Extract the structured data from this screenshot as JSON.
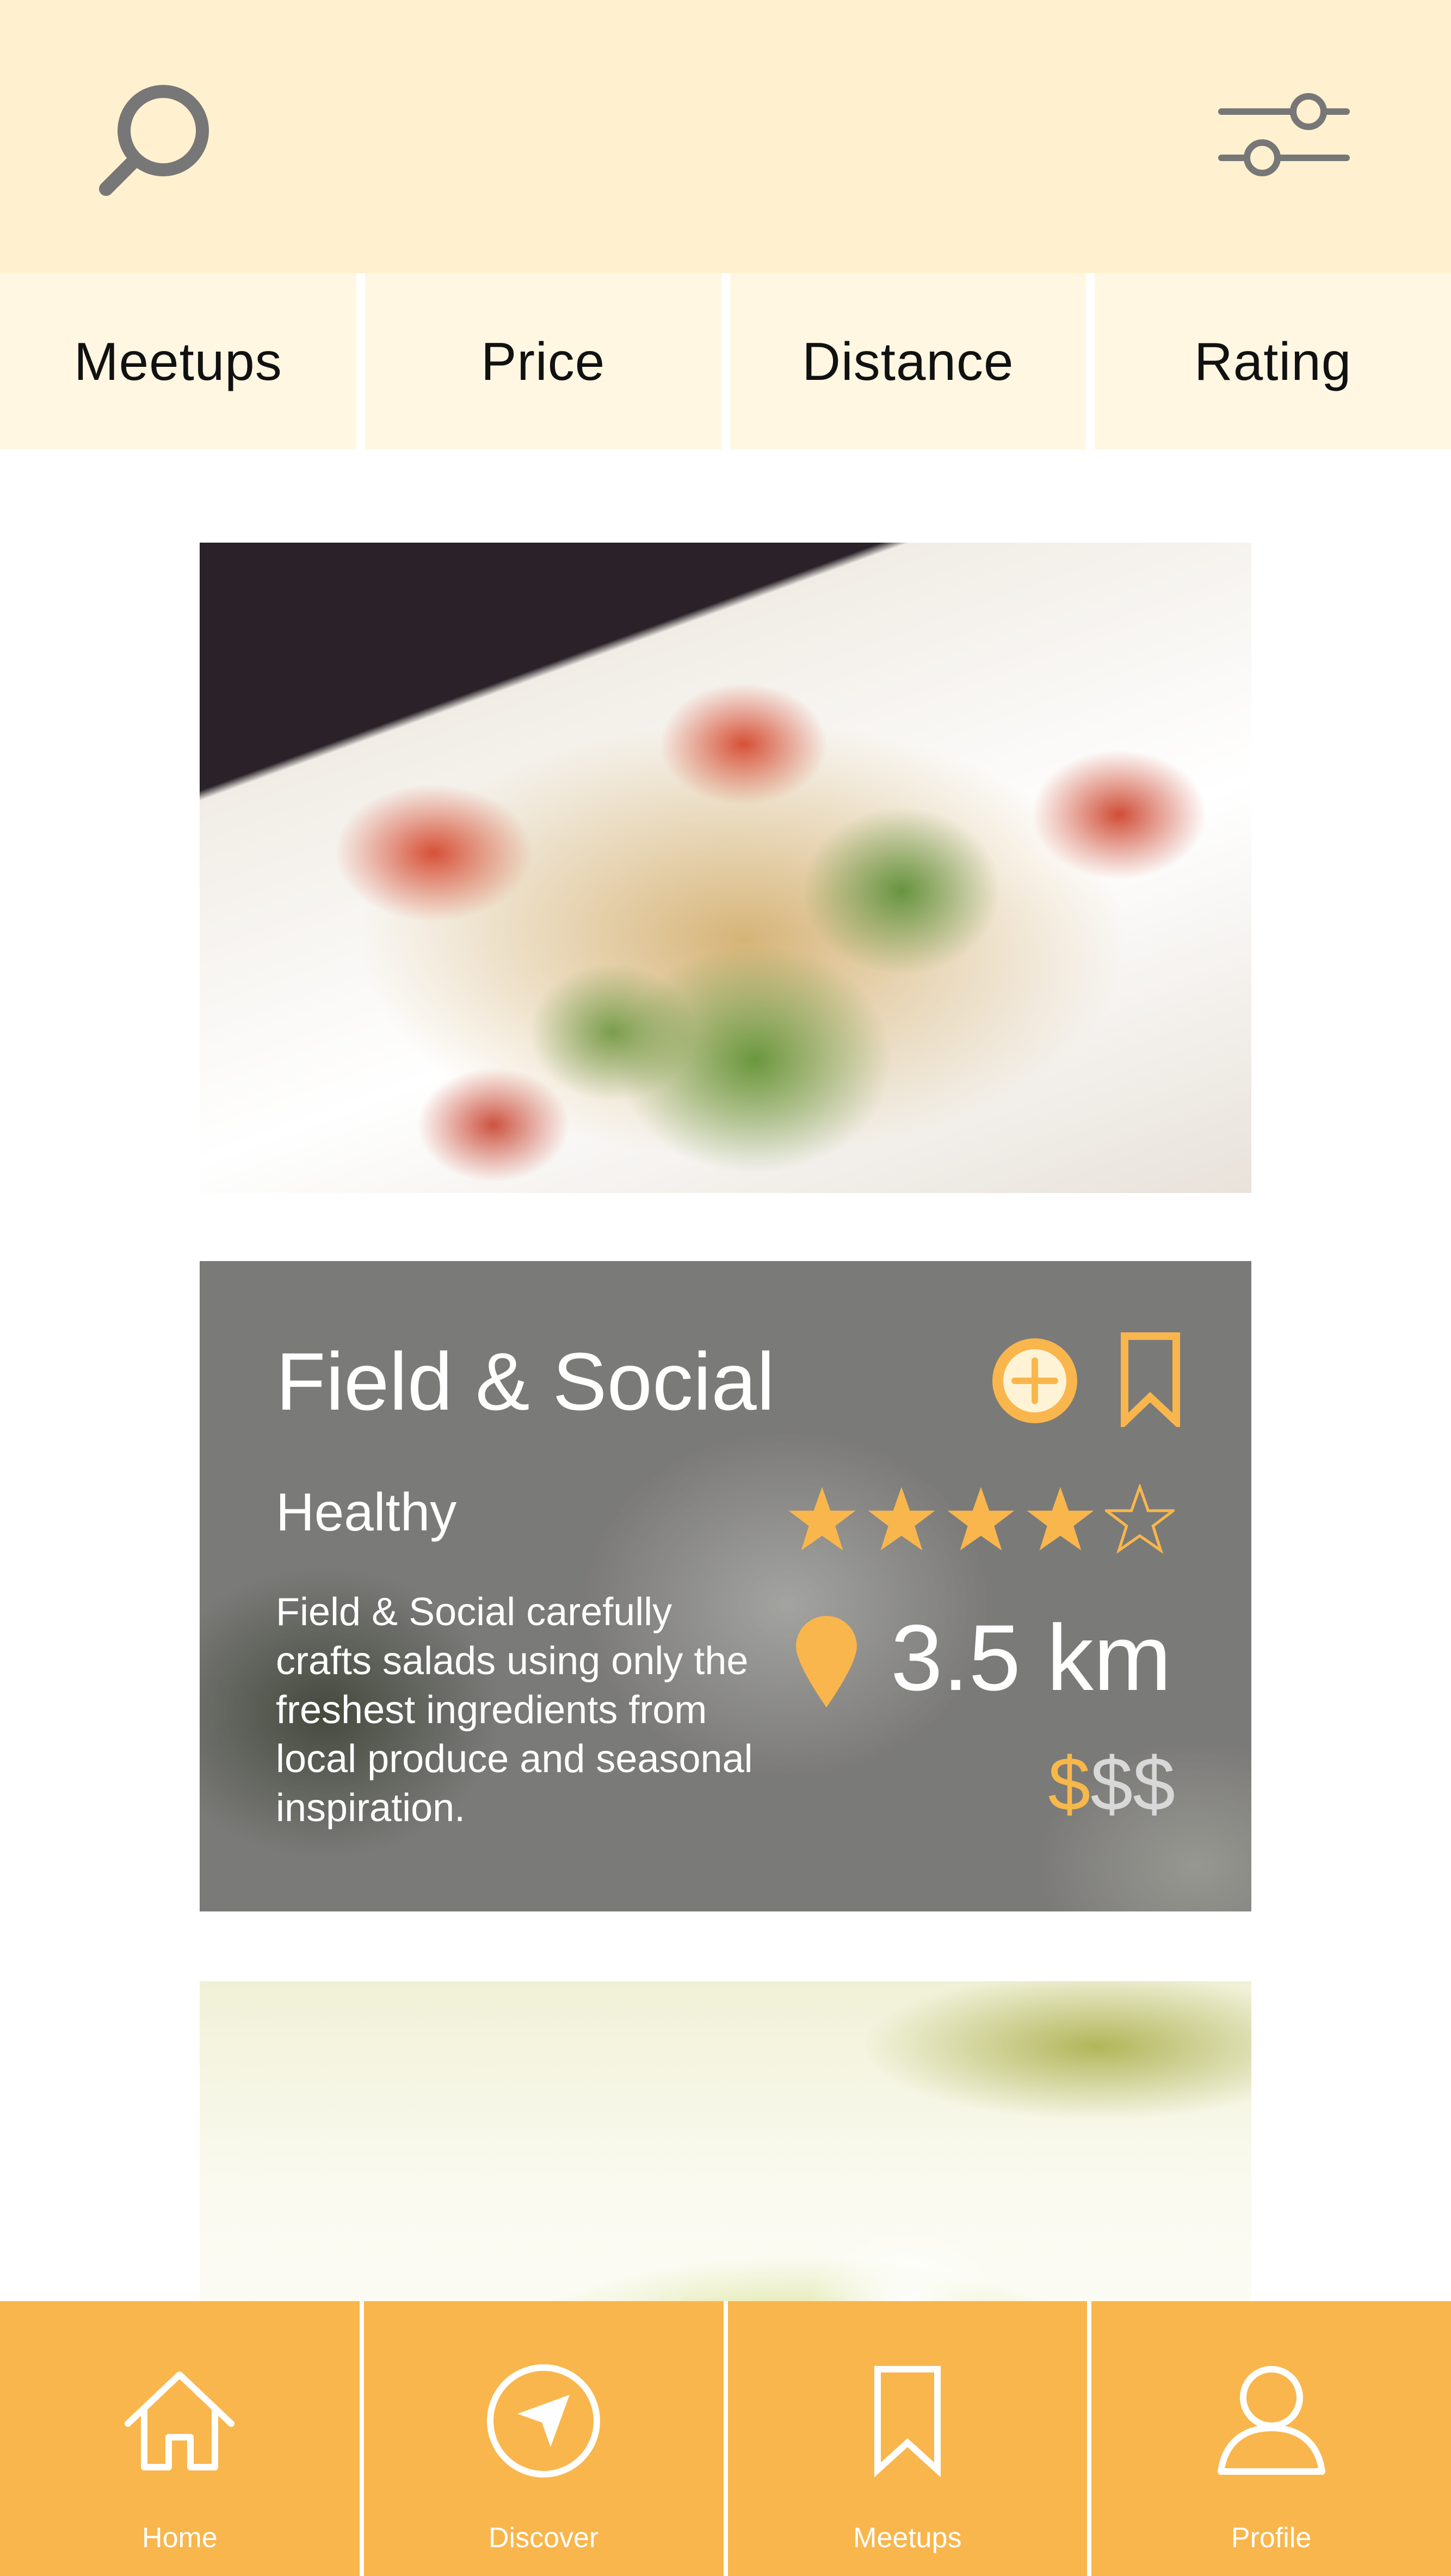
{
  "header": {
    "search_icon": "search-icon",
    "filter_icon": "filter-sliders-icon"
  },
  "filters": [
    "Meetups",
    "Price",
    "Distance",
    "Rating"
  ],
  "restaurant": {
    "name": "Field & Social",
    "category": "Healthy",
    "description": "Field & Social carefully crafts salads using only the freshest ingredients from local produce and seasonal inspiration.",
    "rating": 4,
    "rating_max": 5,
    "distance": "3.5 km",
    "price_active": "$",
    "price_inactive": "$$",
    "icons": [
      "add-circle-icon",
      "bookmark-icon",
      "location-pin-icon"
    ]
  },
  "nav": {
    "items": [
      {
        "label": "Home",
        "icon": "home-icon"
      },
      {
        "label": "Discover",
        "icon": "compass-icon"
      },
      {
        "label": "Meetups",
        "icon": "bookmark-icon"
      },
      {
        "label": "Profile",
        "icon": "profile-icon"
      }
    ]
  },
  "colors": {
    "header_bg": "#fff1cf",
    "tab_bg": "#fff7e2",
    "accent": "#f9b64c",
    "icon_gray": "#777777"
  }
}
